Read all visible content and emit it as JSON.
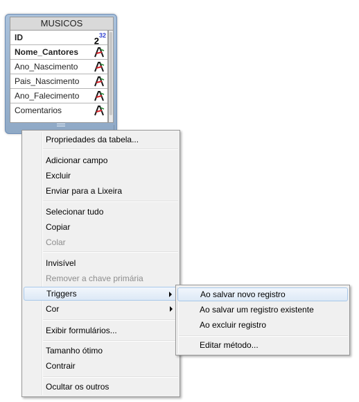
{
  "table": {
    "title": "MUSICOS",
    "fields": [
      {
        "name": "ID",
        "type_icon": "long-integer-icon",
        "type_label": "2",
        "type_sup": "32"
      },
      {
        "name": "Nome_Cantores",
        "type_icon": "alpha-text-icon"
      },
      {
        "name": "Ano_Nascimento",
        "type_icon": "alpha-text-icon"
      },
      {
        "name": "Pais_Nascimento",
        "type_icon": "alpha-text-icon"
      },
      {
        "name": "Ano_Falecimento",
        "type_icon": "alpha-text-icon"
      },
      {
        "name": "Comentarios",
        "type_icon": "alpha-text-icon"
      }
    ],
    "type_icon_colors": {
      "red": "#d8232a",
      "dark": "#1a1a1a",
      "green": "#2e8b3a"
    }
  },
  "context_menu": {
    "items": [
      {
        "label": "Propriedades da tabela...",
        "enabled": true
      },
      {
        "label": "Adicionar campo",
        "enabled": true
      },
      {
        "label": "Excluir",
        "enabled": true
      },
      {
        "label": "Enviar para a Lixeira",
        "enabled": true
      },
      {
        "label": "Selecionar tudo",
        "enabled": true
      },
      {
        "label": "Copiar",
        "enabled": true
      },
      {
        "label": "Colar",
        "enabled": false
      },
      {
        "label": "Invisível",
        "enabled": true
      },
      {
        "label": "Remover a chave primária",
        "enabled": false
      },
      {
        "label": "Triggers",
        "enabled": true,
        "submenu": true,
        "highlighted": true
      },
      {
        "label": "Cor",
        "enabled": true,
        "submenu": true
      },
      {
        "label": "Exibir formulários...",
        "enabled": true
      },
      {
        "label": "Tamanho ótimo",
        "enabled": true
      },
      {
        "label": "Contrair",
        "enabled": true
      },
      {
        "label": "Ocultar os outros",
        "enabled": true
      }
    ]
  },
  "triggers_submenu": {
    "items": [
      {
        "label": "Ao salvar novo registro",
        "highlighted": true
      },
      {
        "label": "Ao salvar um registro existente"
      },
      {
        "label": "Ao excluir registro"
      },
      {
        "label": "Editar método..."
      }
    ]
  },
  "colors": {
    "highlight_border": "#a8c8ea",
    "disabled_text": "#8d8d8d",
    "table_frame": "#8fa9c6"
  }
}
